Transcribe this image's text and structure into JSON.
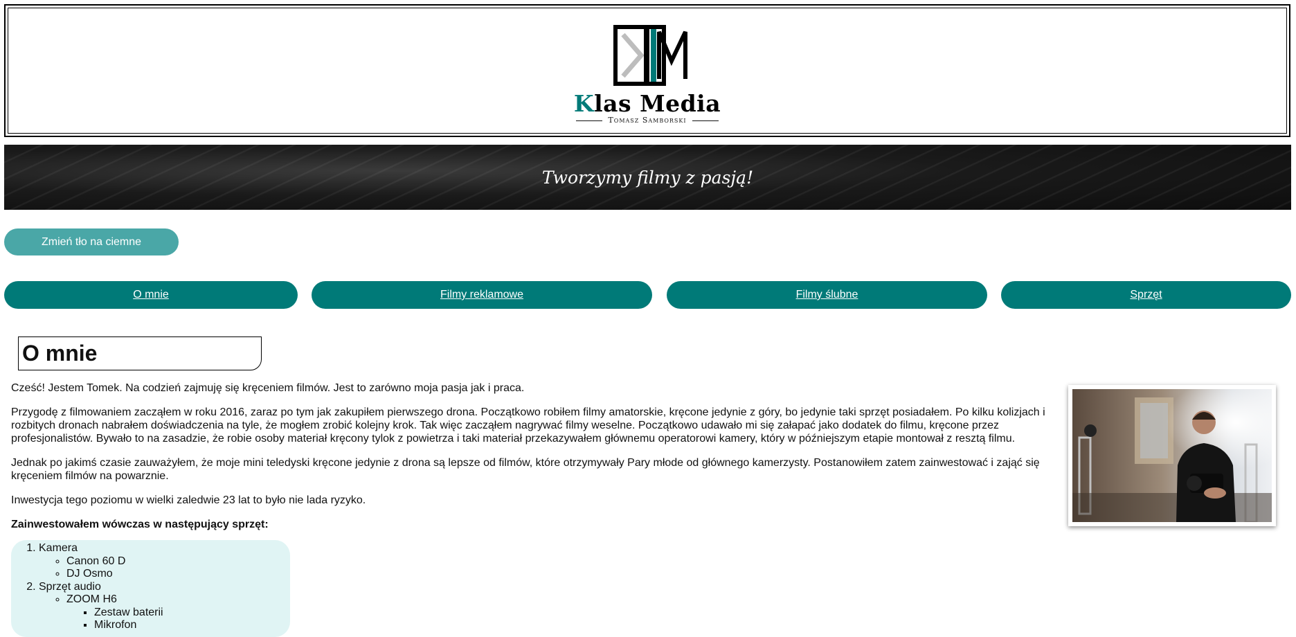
{
  "header": {
    "brand_k": "K",
    "brand_rest": "las Media",
    "brand_sub": "Tomasz Samborski",
    "colors": {
      "accent": "#007a78",
      "light_accent": "#4aa7a7",
      "list_bg": "#e0f4f4"
    }
  },
  "banner": {
    "tagline": "Tworzymy filmy z pasją!"
  },
  "theme_toggle": {
    "label": "Zmień tło na ciemne"
  },
  "nav": [
    {
      "label": "O mnie"
    },
    {
      "label": "Filmy reklamowe"
    },
    {
      "label": "Filmy ślubne"
    },
    {
      "label": "Sprzęt"
    }
  ],
  "section": {
    "title": "O mnie"
  },
  "paragraphs": [
    "Cześć! Jestem Tomek. Na codzień zajmuję się kręceniem filmów. Jest to zarówno moja pasja jak i praca.",
    "Przygodę z filmowaniem zacząłem w roku 2016, zaraz po tym jak zakupiłem pierwszego drona. Początkowo robiłem filmy amatorskie, kręcone jedynie z góry, bo jedynie taki sprzęt posiadałem. Po kilku kolizjach i rozbitych dronach nabrałem doświadczenia na tyle, że mogłem zrobić kolejny krok. Tak więc zacząłem nagrywać filmy weselne. Początkowo udawało mi się załapać jako dodatek do filmu, kręcone przez profesjonalistów. Bywało to na zasadzie, że robie osoby materiał kręcony tylok z powietrza i taki materiał przekazywałem głównemu operatorowi kamery, który w późniejszym etapie montował z resztą filmu.",
    "Jednak po jakimś czasie zauważyłem, że moje mini teledyski kręcone jedynie z drona są lepsze od filmów, które otrzymywały Pary młode od głównego kamerzysty. Postanowiłem zatem zainwestować i zająć się kręceniem filmów na powarznie.",
    "Inwestycja tego poziomu w wielki zaledwie 23 lat to było nie lada ryzyko."
  ],
  "equipment_heading": "Zainwestowałem wówczas w następujący sprzęt:",
  "equipment": {
    "camera": {
      "label": "Kamera",
      "items": [
        "Canon 60 D",
        "DJ Osmo"
      ]
    },
    "audio": {
      "label": "Sprzęt audio",
      "device": "ZOOM H6",
      "accessories": [
        "Zestaw baterii",
        "Mikrofon"
      ]
    }
  }
}
